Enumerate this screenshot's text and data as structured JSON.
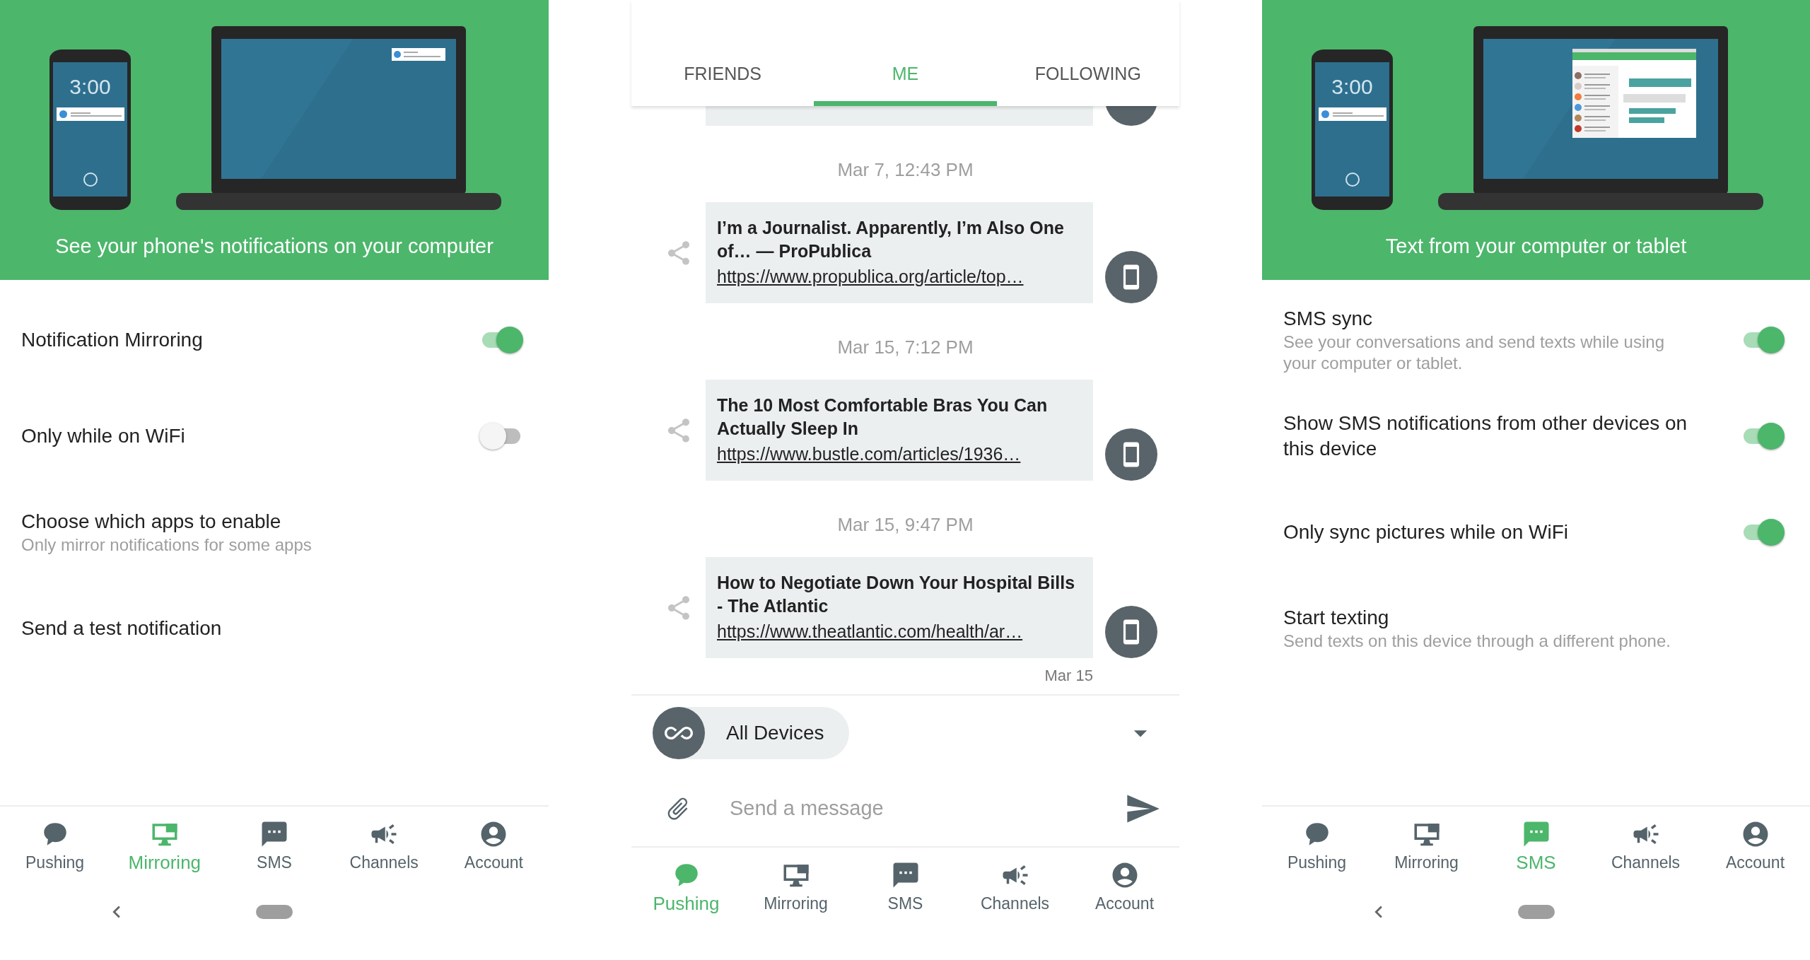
{
  "screens": [
    {
      "kind": "settings",
      "header": {
        "kind": "notification",
        "clock": "3:00",
        "caption": "See your phone's notifications on your computer"
      },
      "settings": [
        {
          "title": "Notification Mirroring",
          "on": true
        },
        {
          "title": "Only while on WiFi",
          "on": false
        },
        {
          "title": "Choose which apps to enable",
          "subtitle": "Only mirror notifications for some apps"
        },
        {
          "title": "Send a test notification"
        }
      ],
      "nav": [
        {
          "label": "Pushing",
          "selected": false
        },
        {
          "label": "Mirroring",
          "selected": true
        },
        {
          "label": "SMS",
          "selected": false
        },
        {
          "label": "Channels",
          "selected": false
        },
        {
          "label": "Account",
          "selected": false
        }
      ]
    },
    {
      "kind": "feed",
      "tabs": [
        {
          "label": "FRIENDS",
          "selected": false
        },
        {
          "label": "ME",
          "selected": true
        },
        {
          "label": "FOLLOWING",
          "selected": false
        }
      ],
      "messages": [
        {
          "time": "Mar 7, 12:43 PM",
          "title": "I’m a Journalist. Apparently, I’m Also One of… — ProPublica",
          "link": "https://www.propublica.org/article/top…"
        },
        {
          "time": "Mar 15, 7:12 PM",
          "title": "The 10 Most Comfortable Bras You Can Actually Sleep In",
          "link": "https://www.bustle.com/articles/1936…"
        },
        {
          "time": "Mar 15, 9:47 PM",
          "title": "How to Negotiate Down Your Hospital Bills - The Atlantic",
          "link": "https://www.theatlantic.com/health/ar…"
        }
      ],
      "last_time": "Mar 15",
      "device_picker": {
        "label": "All Devices"
      },
      "composer": {
        "placeholder": "Send a message"
      },
      "nav": [
        {
          "label": "Pushing",
          "selected": true
        },
        {
          "label": "Mirroring",
          "selected": false
        },
        {
          "label": "SMS",
          "selected": false
        },
        {
          "label": "Channels",
          "selected": false
        },
        {
          "label": "Account",
          "selected": false
        }
      ]
    },
    {
      "kind": "settings",
      "header": {
        "kind": "messages",
        "clock": "3:00",
        "caption": "Text from your computer or tablet"
      },
      "settings": [
        {
          "title": "SMS sync",
          "subtitle": "See your conversations and send texts while using your computer or tablet.",
          "on": true
        },
        {
          "title": "Show SMS notifications from other devices on this device",
          "on": true
        },
        {
          "title": "Only sync pictures while on WiFi",
          "on": true
        },
        {
          "title": "Start texting",
          "subtitle": "Send texts on this device through a different phone."
        }
      ],
      "nav": [
        {
          "label": "Pushing",
          "selected": false
        },
        {
          "label": "Mirroring",
          "selected": false
        },
        {
          "label": "SMS",
          "selected": true
        },
        {
          "label": "Channels",
          "selected": false
        },
        {
          "label": "Account",
          "selected": false
        }
      ]
    }
  ]
}
